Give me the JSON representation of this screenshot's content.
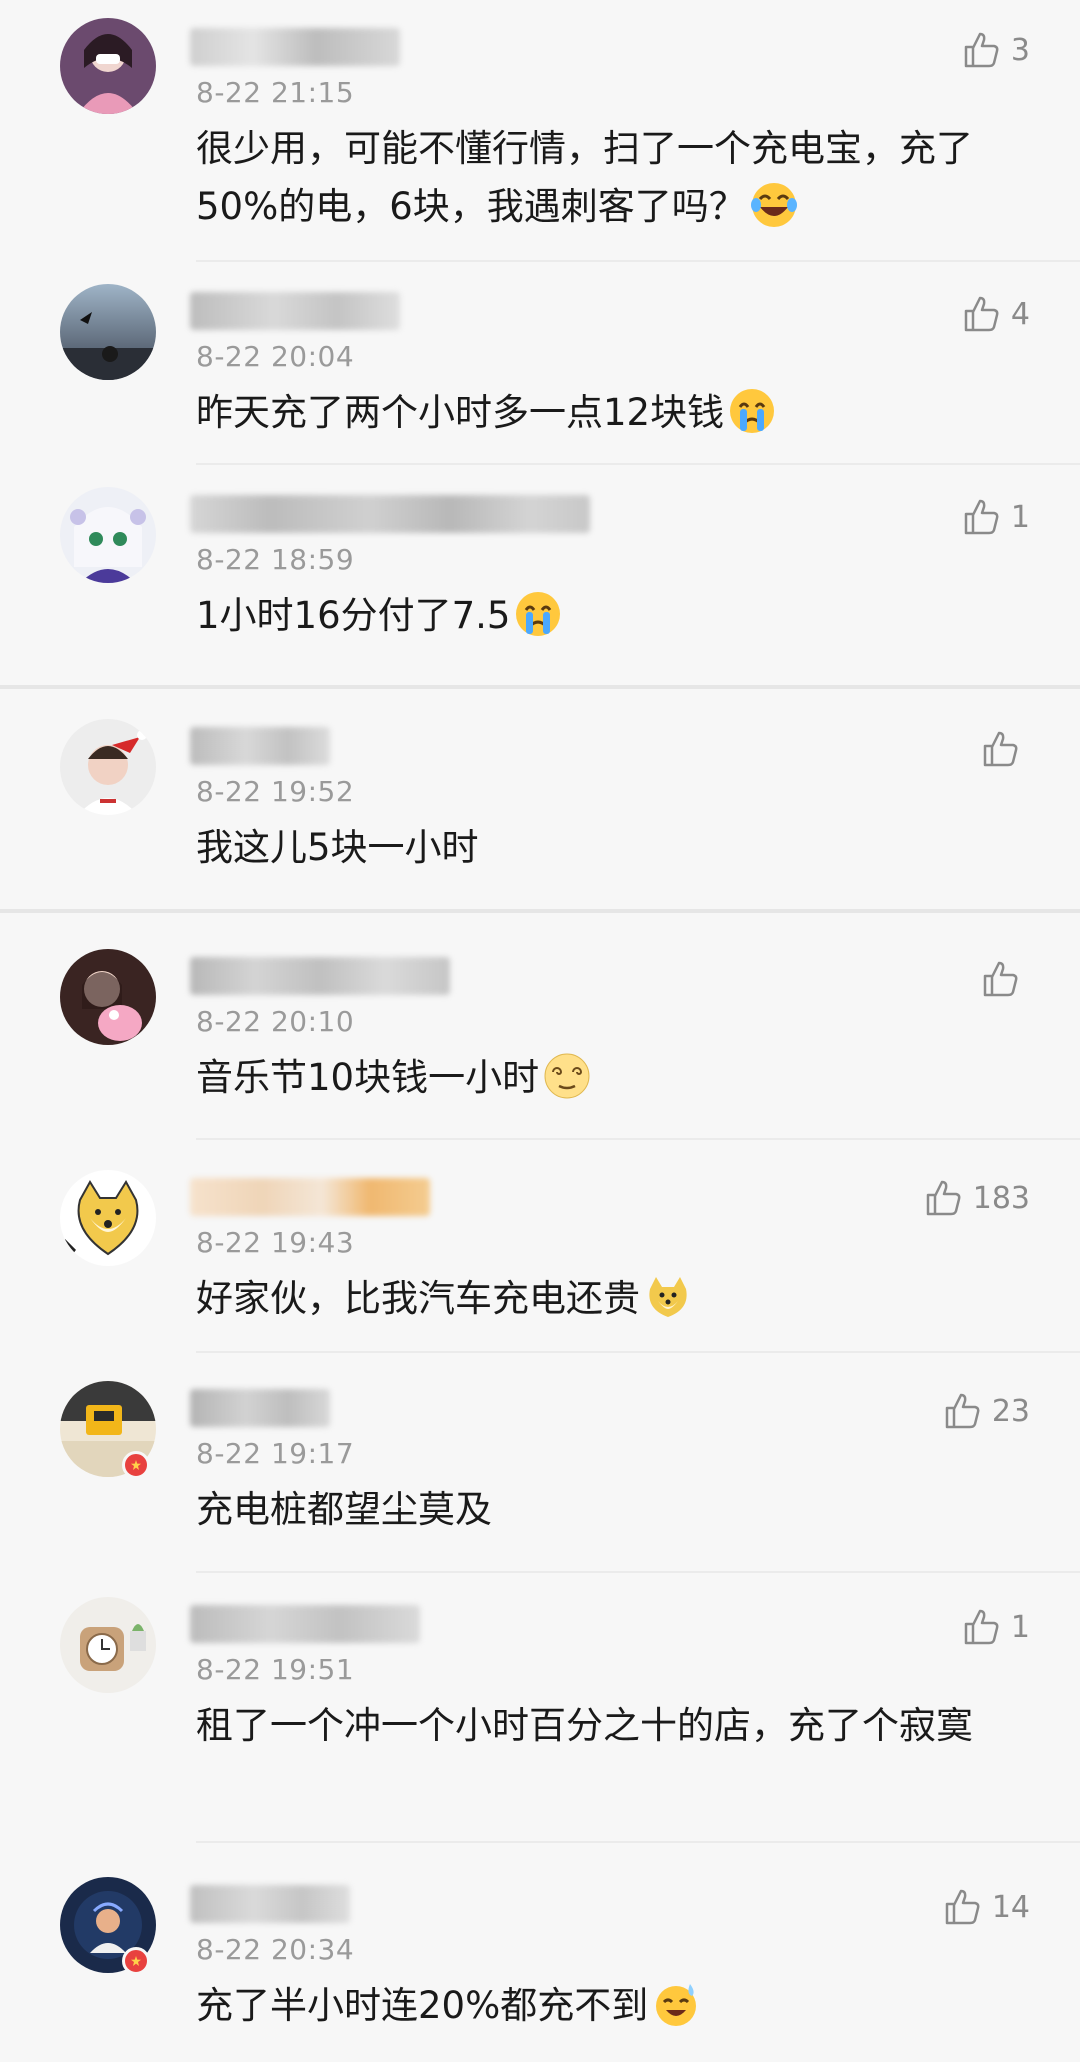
{
  "comments": [
    {
      "time": "8-22 21:15",
      "text": "很少用，可能不懂行情，扫了一个充电宝，充了50%的电，6块，我遇刺客了吗？",
      "emoji": "laugh-cry",
      "likes": "3"
    },
    {
      "time": "8-22 20:04",
      "text": "昨天充了两个小时多一点12块钱",
      "emoji": "crying",
      "likes": "4"
    },
    {
      "time": "8-22 18:59",
      "text": "1小时16分付了7.5",
      "emoji": "crying",
      "likes": "1"
    },
    {
      "time": "8-22 19:52",
      "text": "我这儿5块一小时",
      "emoji": "",
      "likes": ""
    },
    {
      "time": "8-22 20:10",
      "text": "音乐节10块钱一小时",
      "emoji": "dizzy",
      "likes": ""
    },
    {
      "time": "8-22 19:43",
      "text": "好家伙，比我汽车充电还贵",
      "emoji": "doge",
      "likes": "183"
    },
    {
      "time": "8-22 19:17",
      "text": "充电桩都望尘莫及",
      "emoji": "",
      "likes": "23"
    },
    {
      "time": "8-22 19:51",
      "text": "租了一个冲一个小时百分之十的店，充了个寂寞",
      "emoji": "",
      "likes": "1"
    },
    {
      "time": "8-22 20:34",
      "text": "充了半小时连20%都充不到",
      "emoji": "sweat-smile",
      "likes": "14"
    }
  ],
  "icons": {
    "like": "thumbs-up-icon"
  },
  "colors": {
    "background": "#f7f7f7",
    "time": "#9a9a9a",
    "text": "#1a1a1a",
    "like": "#8a8a8a",
    "badge": "#e8413f"
  }
}
